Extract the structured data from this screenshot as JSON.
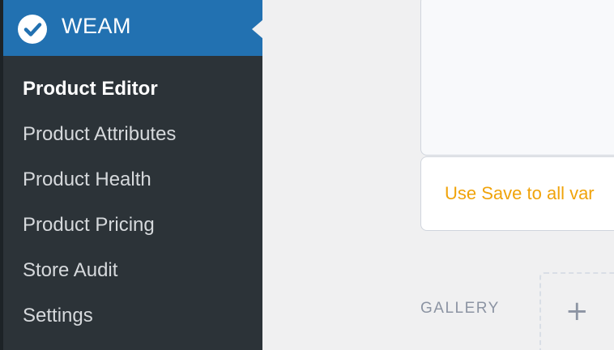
{
  "sidebar": {
    "title": "WEAM",
    "icon": "check-circle-icon",
    "items": [
      {
        "label": "Product Editor",
        "current": true
      },
      {
        "label": "Product Attributes",
        "current": false
      },
      {
        "label": "Product Health",
        "current": false
      },
      {
        "label": "Product Pricing",
        "current": false
      },
      {
        "label": "Store Audit",
        "current": false
      },
      {
        "label": "Settings",
        "current": false
      }
    ]
  },
  "main": {
    "note": "Use Save to all var",
    "gallery_label": "GALLERY",
    "add_symbol": "+"
  },
  "colors": {
    "sidebar_bg": "#2c3338",
    "accent": "#2271b1",
    "note_text": "#f0a30a"
  }
}
